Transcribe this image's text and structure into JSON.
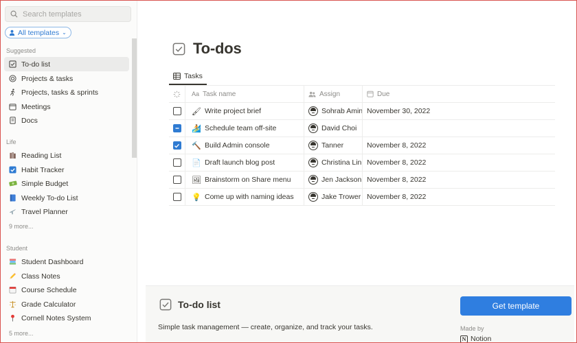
{
  "sidebar": {
    "search_placeholder": "Search templates",
    "filter_label": "All templates",
    "sections": [
      {
        "label": "Suggested",
        "items": [
          {
            "label": "To-do list",
            "icon": "checkbox-icon",
            "active": true
          },
          {
            "label": "Projects & tasks",
            "icon": "target-icon"
          },
          {
            "label": "Projects, tasks & sprints",
            "icon": "runner-icon"
          },
          {
            "label": "Meetings",
            "icon": "calendar-icon"
          },
          {
            "label": "Docs",
            "icon": "document-icon"
          }
        ]
      },
      {
        "label": "Life",
        "items": [
          {
            "label": "Reading List",
            "icon": "books-icon"
          },
          {
            "label": "Habit Tracker",
            "icon": "checked-box-icon"
          },
          {
            "label": "Simple Budget",
            "icon": "money-icon"
          },
          {
            "label": "Weekly To-do List",
            "icon": "notebook-icon"
          },
          {
            "label": "Travel Planner",
            "icon": "airplane-icon"
          }
        ],
        "more": "9 more..."
      },
      {
        "label": "Student",
        "items": [
          {
            "label": "Student Dashboard",
            "icon": "books-stack-icon"
          },
          {
            "label": "Class Notes",
            "icon": "pencil-icon"
          },
          {
            "label": "Course Schedule",
            "icon": "calendar-icon"
          },
          {
            "label": "Grade Calculator",
            "icon": "scales-icon"
          },
          {
            "label": "Cornell Notes System",
            "icon": "pin-icon"
          }
        ],
        "more": "5 more..."
      }
    ]
  },
  "main": {
    "title": "To-dos",
    "tab": "Tasks",
    "columns": {
      "name": "Task name",
      "assign": "Assign",
      "due": "Due"
    },
    "rows": [
      {
        "status": "unchecked",
        "icon": "paintbrush-icon",
        "emoji": "🖌",
        "name": "Write project brief",
        "assignee": "Sohrab Amin",
        "due": "November 30, 2022"
      },
      {
        "status": "partial",
        "icon": "surfer-icon",
        "emoji": "🏄",
        "name": "Schedule team off-site",
        "assignee": "David Choi",
        "due": ""
      },
      {
        "status": "checked",
        "icon": "hammer-icon",
        "emoji": "🔨",
        "name": "Build Admin console",
        "assignee": "Tanner",
        "due": "November 8, 2022"
      },
      {
        "status": "unchecked",
        "icon": "page-icon",
        "emoji": "📄",
        "name": "Draft launch blog post",
        "assignee": "Christina Lin",
        "due": "November 8, 2022"
      },
      {
        "status": "unchecked",
        "icon": "frame-icon",
        "emoji": "🖼",
        "name": "Brainstorm on Share menu",
        "assignee": "Jen Jackson",
        "due": "November 8, 2022"
      },
      {
        "status": "unchecked",
        "icon": "lightbulb-icon",
        "emoji": "💡",
        "name": "Come up with naming ideas",
        "assignee": "Jake Trower",
        "due": "November 8, 2022"
      }
    ]
  },
  "panel": {
    "title": "To-do list",
    "description": "Simple task management — create, organize, and track your tasks.",
    "button": "Get template",
    "made_by_label": "Made by",
    "maker": "Notion",
    "maker_logo": "N"
  },
  "colors": {
    "accent": "#2f7ee0",
    "checkbox_blue": "#2f7bd2",
    "text": "#37352f",
    "muted": "#8c8b88"
  }
}
